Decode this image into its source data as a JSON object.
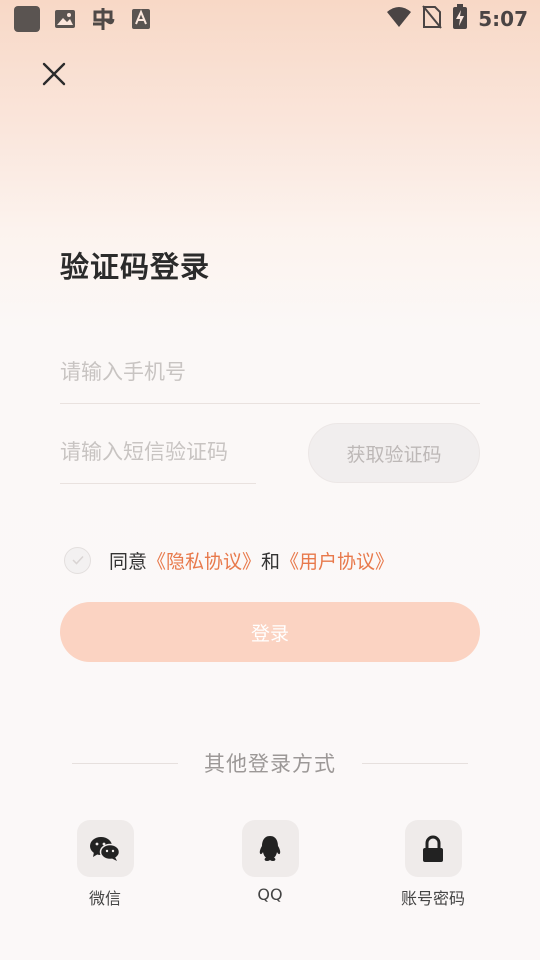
{
  "status_bar": {
    "time": "5:07",
    "left_icons": [
      "app-icon",
      "image-icon",
      "bug-icon",
      "font-icon"
    ],
    "right_icons": [
      "wifi-icon",
      "no-sim-icon",
      "battery-charging-icon"
    ]
  },
  "close_icon": "close-icon",
  "title": "验证码登录",
  "phone": {
    "placeholder": "请输入手机号",
    "value": ""
  },
  "code": {
    "placeholder": "请输入短信验证码",
    "value": ""
  },
  "get_code_label": "获取验证码",
  "agreement": {
    "prefix": "同意",
    "privacy_link": "《隐私协议》",
    "conjunction": "和",
    "user_link": "《用户协议》",
    "checked": false
  },
  "login_label": "登录",
  "other_methods_label": "其他登录方式",
  "social": [
    {
      "label": "微信",
      "icon": "wechat-icon"
    },
    {
      "label": "QQ",
      "icon": "qq-icon"
    },
    {
      "label": "账号密码",
      "icon": "lock-icon"
    }
  ],
  "colors": {
    "accent": "#e8794b",
    "login_button": "#fbd3c2",
    "header_gradient_top": "#f8d8c6"
  }
}
